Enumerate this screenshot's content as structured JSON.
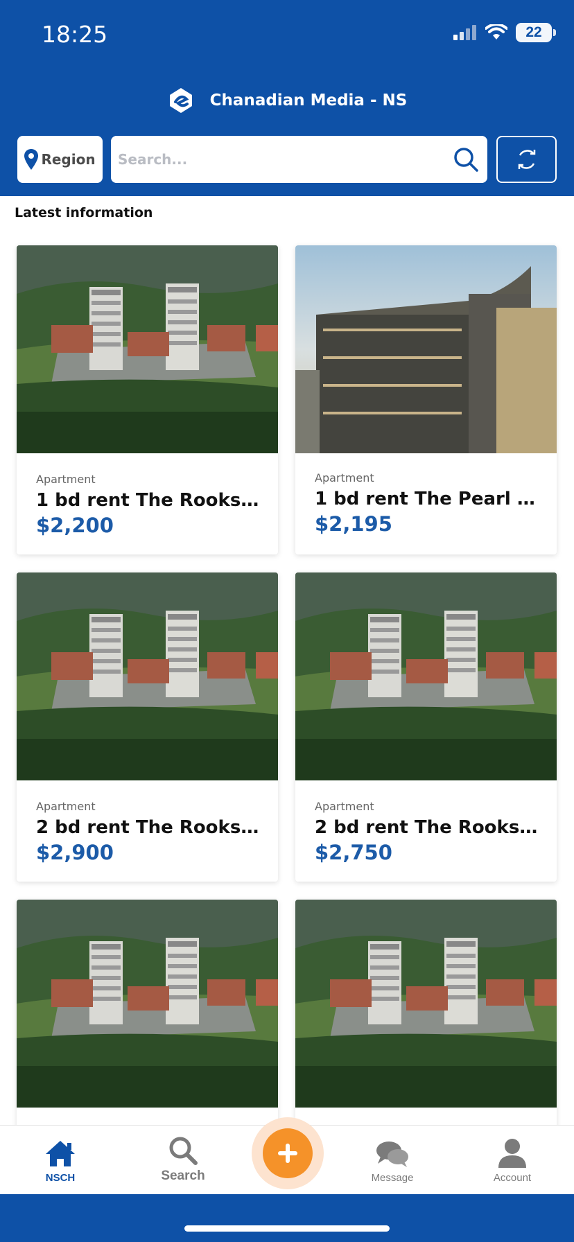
{
  "status_bar": {
    "time": "18:25",
    "battery": "22"
  },
  "header": {
    "title": "Chanadian Media - NS"
  },
  "filter": {
    "region_label": "Region",
    "search_placeholder": "Search..."
  },
  "section": {
    "title": "Latest information"
  },
  "listings": [
    {
      "category": "Apartment",
      "title": "1 bd rent The Rooks of ...",
      "price": "$2,200",
      "image": "aerial-apartment-towers"
    },
    {
      "category": "Apartment",
      "title": "1 bd rent The Pearl Apar...",
      "price": "$2,195",
      "image": "glass-condo-building"
    },
    {
      "category": "Apartment",
      "title": "2 bd rent The Rooks of ...",
      "price": "$2,900",
      "image": "aerial-apartment-towers"
    },
    {
      "category": "Apartment",
      "title": "2 bd rent The Rooks of ...",
      "price": "$2,750",
      "image": "aerial-apartment-towers"
    },
    {
      "category": "",
      "title": "",
      "price": "",
      "image": "aerial-apartment-towers"
    },
    {
      "category": "",
      "title": "",
      "price": "",
      "image": "aerial-apartment-towers"
    }
  ],
  "tabs": [
    {
      "label": "NSCH",
      "icon": "home-icon",
      "active": true
    },
    {
      "label": "Search",
      "icon": "search-icon",
      "active": false
    },
    {
      "label": "Message",
      "icon": "message-icon",
      "active": false
    },
    {
      "label": "Account",
      "icon": "account-icon",
      "active": false
    }
  ],
  "colors": {
    "brand": "#0e51a7",
    "price": "#1c5ba8",
    "fab": "#f59229"
  }
}
